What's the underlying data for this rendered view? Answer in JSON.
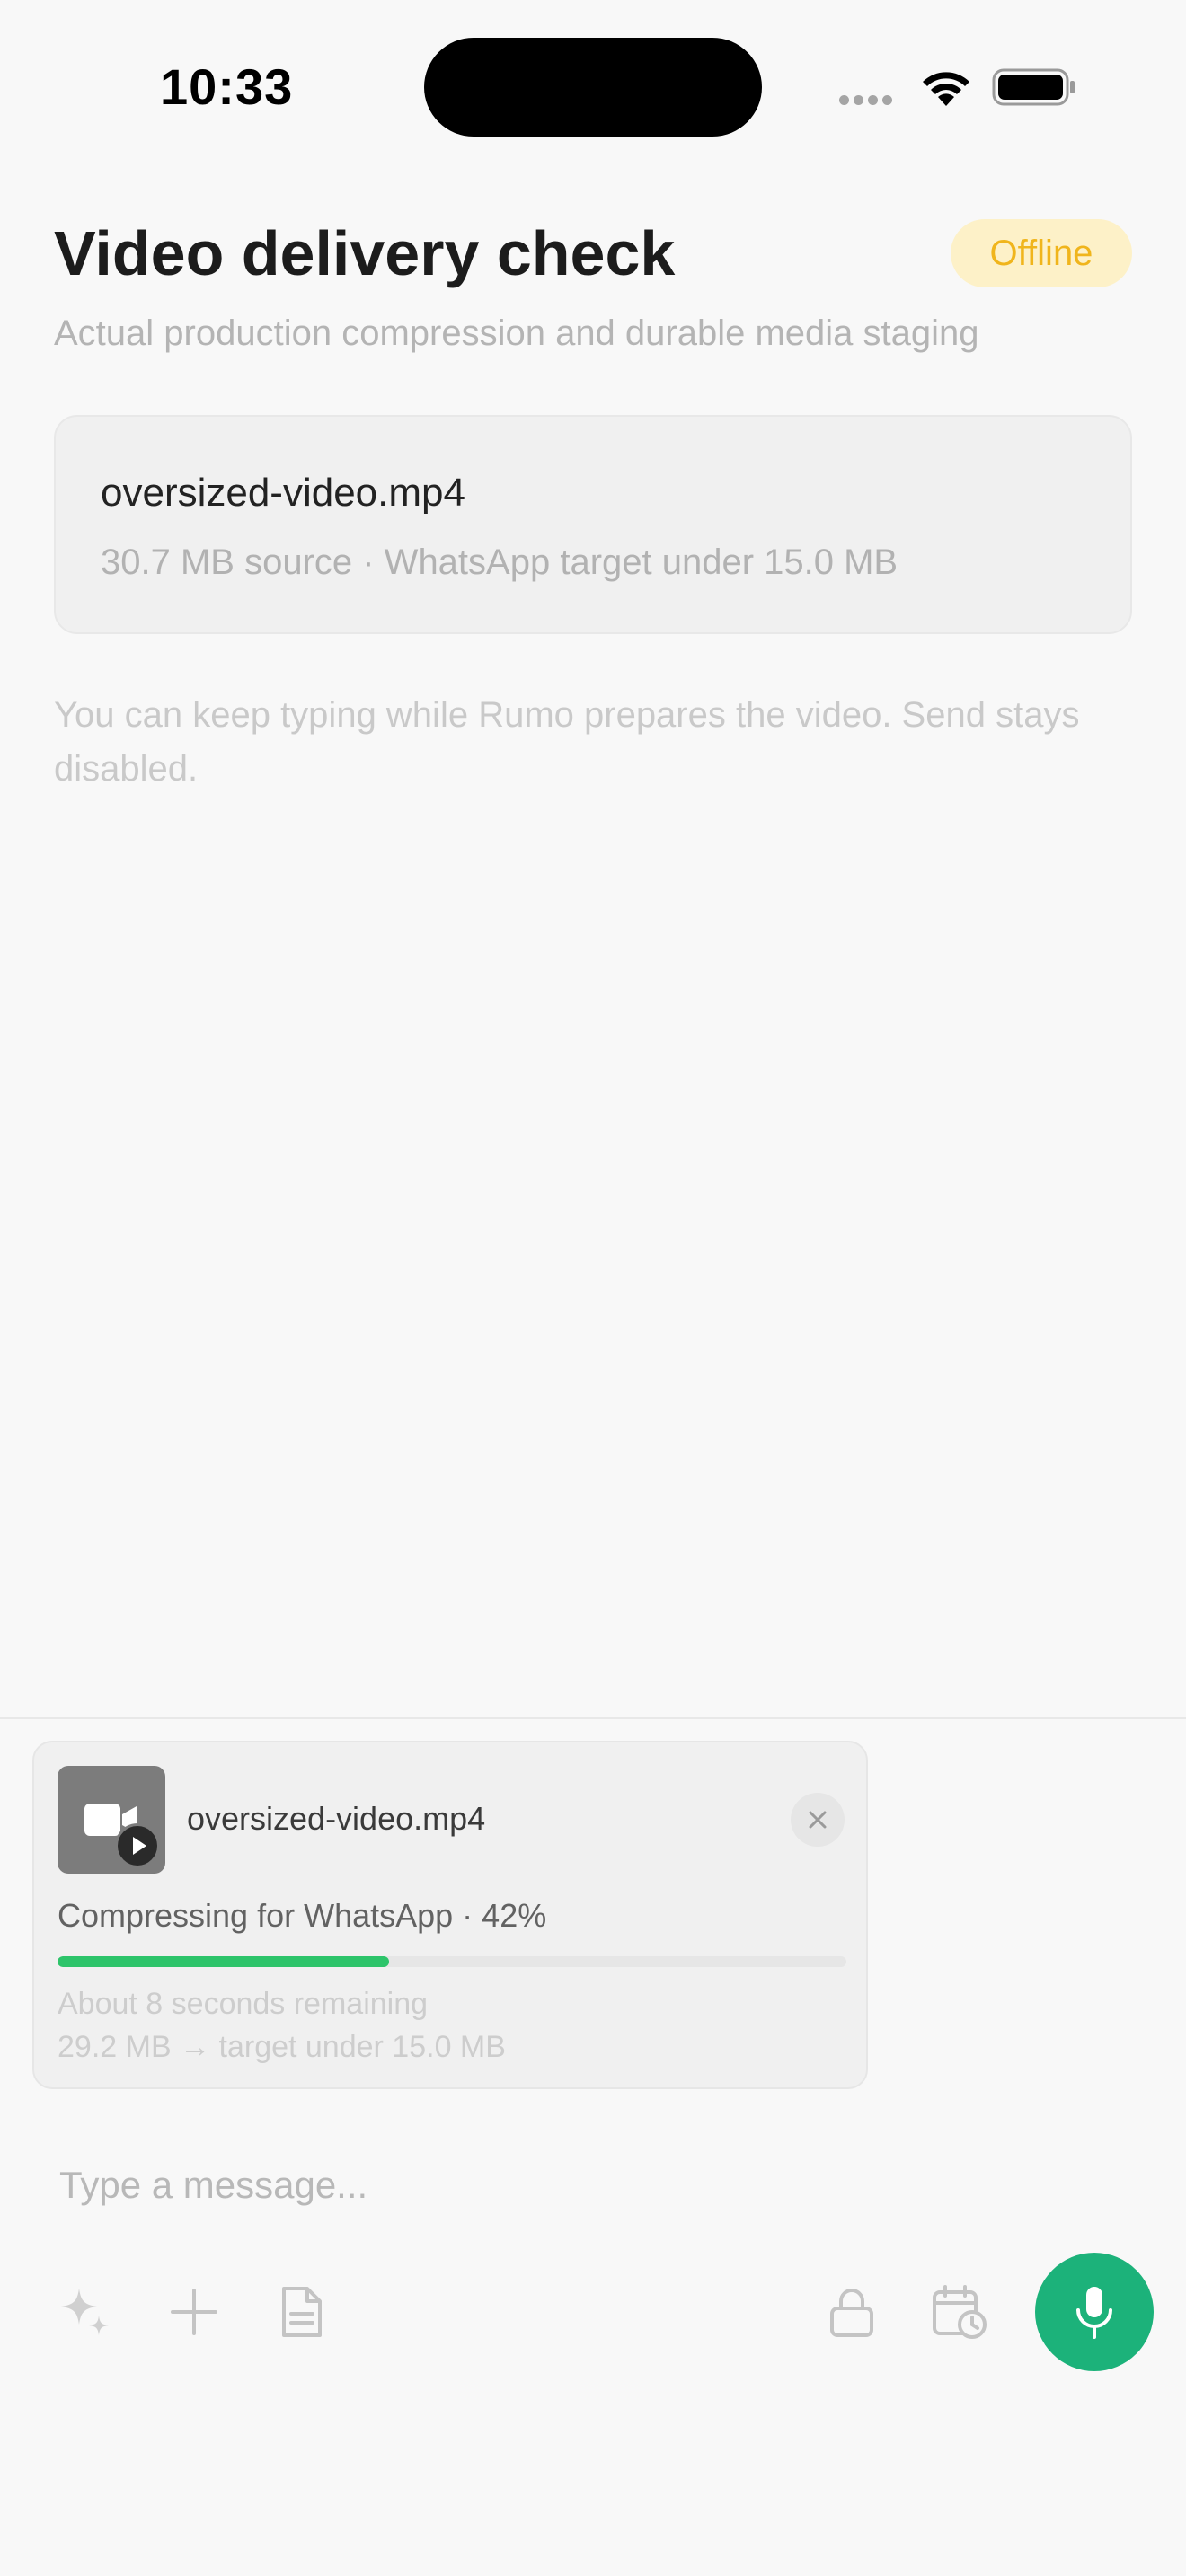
{
  "status_bar": {
    "time": "10:33"
  },
  "header": {
    "title": "Video delivery check",
    "status_badge": "Offline",
    "subtitle": "Actual production compression and durable media staging"
  },
  "file_card": {
    "file_name": "oversized-video.mp4",
    "meta": "30.7 MB source · WhatsApp target under 15.0 MB"
  },
  "hint": "You can keep typing while Rumo prepares the video. Send stays disabled.",
  "compression": {
    "file_name": "oversized-video.mp4",
    "status": "Compressing for WhatsApp · 42%",
    "progress_fraction": 0.42,
    "remaining": "About 8 seconds remaining",
    "size_info": "29.2 MB → target under 15.0 MB"
  },
  "composer": {
    "placeholder": "Type a message...",
    "value": ""
  },
  "icons": [
    "sparkles-icon",
    "plus-icon",
    "document-icon",
    "lock-icon",
    "calendar-clock-icon",
    "microphone-icon",
    "video-camera-icon",
    "play-icon",
    "close-icon"
  ],
  "colors": {
    "accent_green": "#1cb27a",
    "progress_green": "#2dc46a",
    "badge_bg": "#fdf1c8",
    "badge_text": "#f0b51c"
  }
}
